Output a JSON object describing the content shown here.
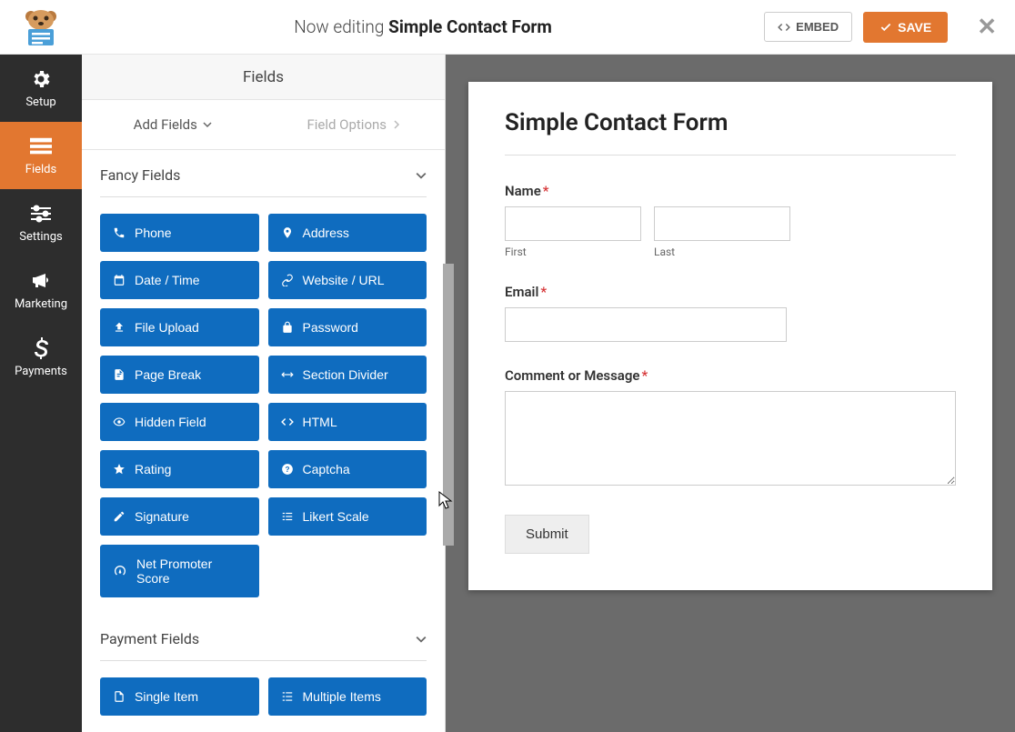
{
  "header": {
    "editing_prefix": "Now editing",
    "form_name": "Simple Contact Form",
    "embed_label": "EMBED",
    "save_label": "SAVE"
  },
  "rail": {
    "setup": "Setup",
    "fields": "Fields",
    "settings": "Settings",
    "marketing": "Marketing",
    "payments": "Payments"
  },
  "panel": {
    "title": "Fields",
    "tab_add": "Add Fields",
    "tab_options": "Field Options"
  },
  "sections": {
    "fancy": "Fancy Fields",
    "payment": "Payment Fields"
  },
  "fancy_fields": [
    "Phone",
    "Address",
    "Date / Time",
    "Website / URL",
    "File Upload",
    "Password",
    "Page Break",
    "Section Divider",
    "Hidden Field",
    "HTML",
    "Rating",
    "Captcha",
    "Signature",
    "Likert Scale"
  ],
  "fancy_single": "Net Promoter Score",
  "payment_fields": [
    "Single Item",
    "Multiple Items"
  ],
  "form": {
    "title": "Simple Contact Form",
    "name_label": "Name",
    "first_sub": "First",
    "last_sub": "Last",
    "email_label": "Email",
    "comment_label": "Comment or Message",
    "submit_label": "Submit"
  }
}
